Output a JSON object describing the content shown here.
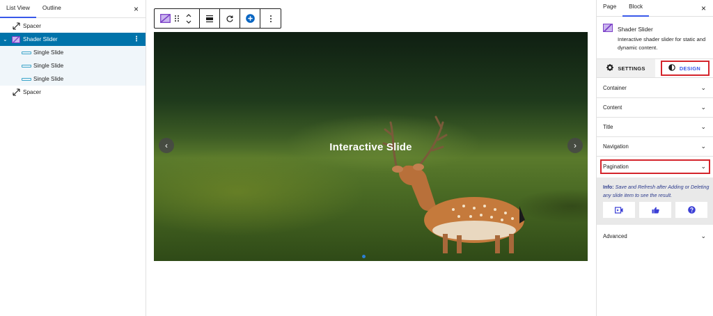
{
  "left_panel": {
    "tabs": [
      "List View",
      "Outline"
    ],
    "close_symbol": "×",
    "tree": [
      {
        "label": "Spacer",
        "icon": "resize-arrows-icon"
      },
      {
        "label": "Shader Slider",
        "icon": "shader-slider-icon",
        "selected": true
      },
      {
        "label": "Single Slide",
        "icon": "slide-icon"
      },
      {
        "label": "Single Slide",
        "icon": "slide-icon"
      },
      {
        "label": "Single Slide",
        "icon": "slide-icon"
      },
      {
        "label": "Spacer",
        "icon": "resize-arrows-icon"
      }
    ]
  },
  "toolbar": {
    "icons": [
      "shader-slider-icon",
      "drag-handle-icon",
      "move-up-down-icon",
      "align-icon",
      "refresh-icon",
      "add-icon",
      "more-options-icon"
    ]
  },
  "slider": {
    "title": "Interactive Slide",
    "prev_symbol": "‹",
    "next_symbol": "›",
    "active_dot_color": "#2c7fd3"
  },
  "right_panel": {
    "tabs": [
      "Page",
      "Block"
    ],
    "close_symbol": "×",
    "block_name": "Shader Slider",
    "block_desc": "Interactive shader slider for static and dynamic content.",
    "settings_label": "SETTINGS",
    "design_label": "DESIGN",
    "accordions": [
      "Container",
      "Content",
      "Title",
      "Navigation",
      "Pagination"
    ],
    "advanced_label": "Advanced",
    "info_label": "Info:",
    "info_text": "Save and Refresh after Adding or Deleting any slide item to see the result.",
    "info_buttons": [
      "video-icon",
      "thumbs-up-icon",
      "help-icon"
    ],
    "accent_color": "#3858e9",
    "highlight_color": "#d4242b"
  }
}
